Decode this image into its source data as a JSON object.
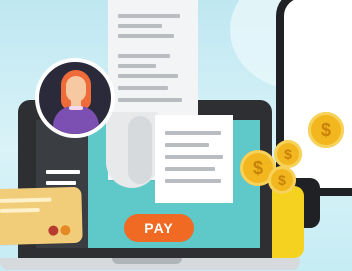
{
  "screen": {
    "pay_button_label": "PAY"
  },
  "coins": [
    {
      "symbol": "$"
    },
    {
      "symbol": "$"
    },
    {
      "symbol": "$"
    },
    {
      "symbol": "$"
    }
  ],
  "colors": {
    "background": "#cdeef5",
    "laptop_body": "#2d2f33",
    "screen": "#5fc8c9",
    "pay_button": "#f06a23",
    "card": "#f1cd79",
    "coin": "#f2b71f",
    "avatar_shirt": "#7c4fb2",
    "avatar_hair": "#f06b3a"
  },
  "icons": {
    "avatar": "user-avatar-icon",
    "receipt": "receipt-icon",
    "card": "credit-card-icon",
    "coin": "dollar-coin-icon"
  }
}
